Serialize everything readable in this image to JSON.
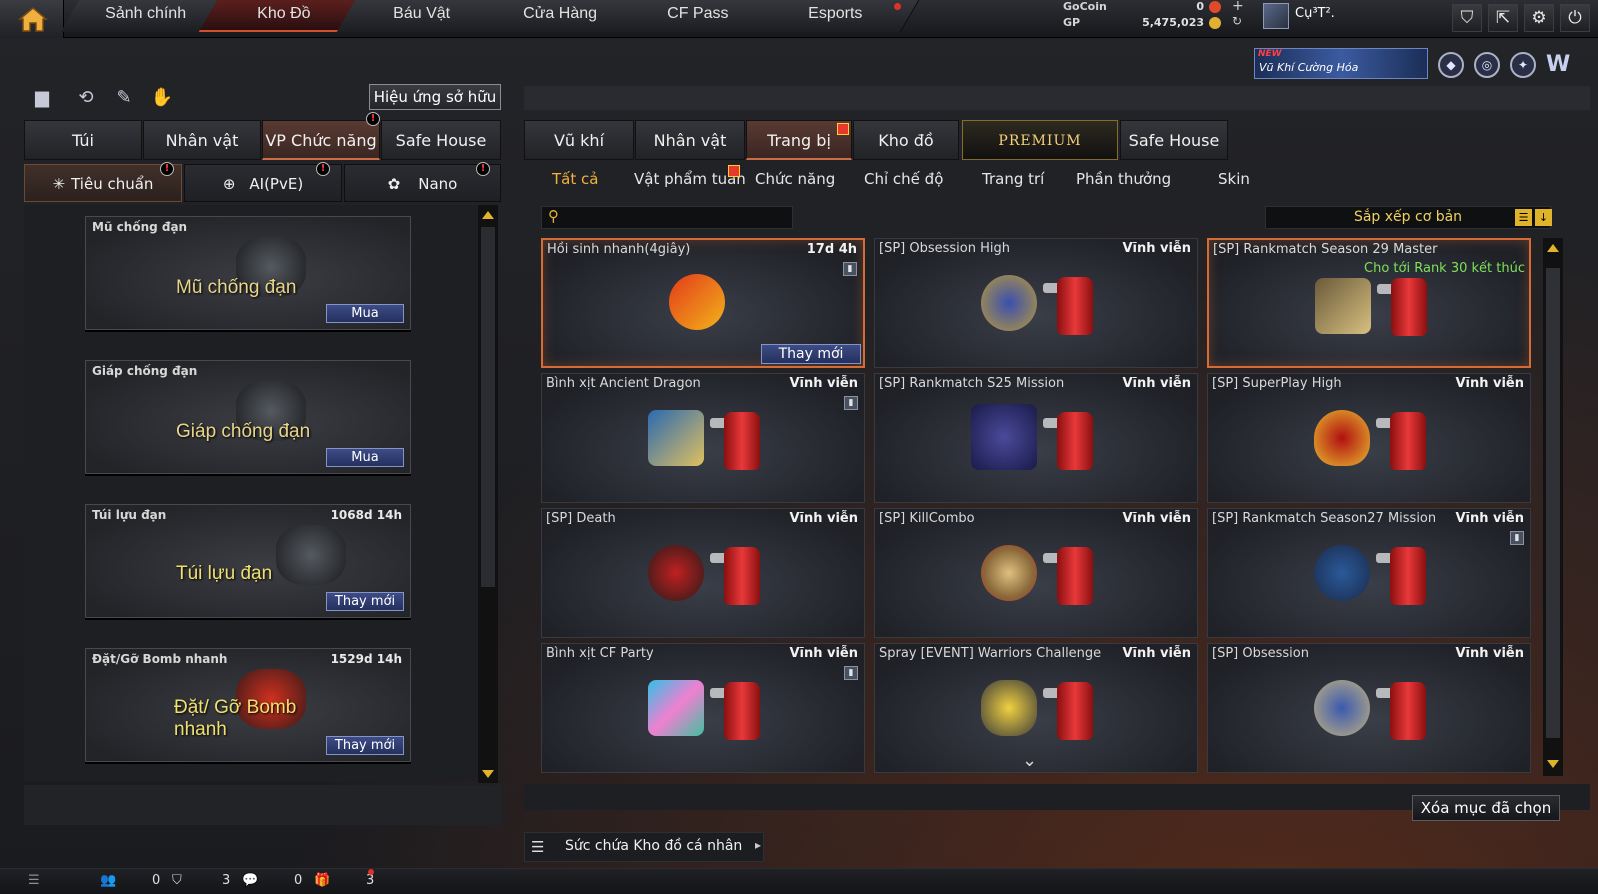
{
  "topbar": {
    "tabs": [
      {
        "label": "Sảnh chính"
      },
      {
        "label": "Kho Đồ"
      },
      {
        "label": "Báu Vật"
      },
      {
        "label": "Cửa Hàng"
      },
      {
        "label": "CF Pass"
      },
      {
        "label": "Esports"
      }
    ],
    "active_tab": 1,
    "currency": [
      {
        "label": "GoCoin",
        "value": "0"
      },
      {
        "label": "GP",
        "value": "5,475,023"
      }
    ],
    "username": "Cụ³T².",
    "accent_color": "#d0502c"
  },
  "banner": {
    "new": "NEW",
    "text": "Vũ Khí Cường Hóa"
  },
  "left": {
    "effects_button": "Hiệu ứng sở hữu",
    "tabs": [
      "Túi",
      "Nhân vật",
      "VP Chức năng",
      "Safe House"
    ],
    "active_tab": 2,
    "subtabs": [
      "Tiêu chuẩn",
      "AI(PvE)",
      "Nano"
    ],
    "active_subtab": 0,
    "items": [
      {
        "title": "Mũ chống đạn",
        "duration": "",
        "art": "Mũ chống đạn",
        "button": "Mua"
      },
      {
        "title": "Giáp chống đạn",
        "duration": "",
        "art": "Giáp chống đạn",
        "button": "Mua"
      },
      {
        "title": "Túi lựu đạn",
        "duration": "1068d 14h",
        "art": "Túi lựu đạn",
        "button": "Thay mới"
      },
      {
        "title": "Đặt/Gỡ Bomb nhanh",
        "duration": "1529d 14h",
        "art": "Đặt/ Gỡ Bomb nhanh",
        "button": "Thay mới"
      }
    ]
  },
  "right": {
    "tabs": [
      "Vũ khí",
      "Nhân vật",
      "Trang bị",
      "Kho đồ",
      "PREMIUM",
      "Safe House"
    ],
    "active_tab": 2,
    "categories": [
      "Tất cả",
      "Vật phẩm tuần",
      "Chức năng",
      "Chỉ chế độ",
      "Trang trí",
      "Phần thưởng",
      "Skin"
    ],
    "active_category": 0,
    "search_placeholder": "",
    "sort_label": "Sắp xếp cơ bản",
    "items": [
      {
        "title": "Hồi sinh nhanh(4giây)",
        "duration": "17d 4h",
        "sub": "",
        "button": "Thay mới",
        "selected": true
      },
      {
        "title": "[SP] Obsession High",
        "duration": "Vĩnh viễn",
        "sub": "",
        "button": "",
        "selected": false
      },
      {
        "title": "[SP] Rankmatch Season 29 Master",
        "duration": "",
        "sub": "Cho tới Rank 30 kết thúc",
        "button": "",
        "selected": true
      },
      {
        "title": "Bình xịt Ancient Dragon",
        "duration": "Vĩnh viễn",
        "sub": "",
        "button": "",
        "selected": false
      },
      {
        "title": "[SP] Rankmatch S25 Mission",
        "duration": "Vĩnh viễn",
        "sub": "",
        "button": "",
        "selected": false
      },
      {
        "title": "[SP] SuperPlay High",
        "duration": "Vĩnh viễn",
        "sub": "",
        "button": "",
        "selected": false
      },
      {
        "title": "[SP] Death",
        "duration": "Vĩnh viễn",
        "sub": "",
        "button": "",
        "selected": false
      },
      {
        "title": "[SP] KillCombo",
        "duration": "Vĩnh viễn",
        "sub": "",
        "button": "",
        "selected": false
      },
      {
        "title": "[SP] Rankmatch Season27 Mission",
        "duration": "Vĩnh viễn",
        "sub": "",
        "button": "",
        "selected": false
      },
      {
        "title": "Bình xịt CF Party",
        "duration": "Vĩnh viễn",
        "sub": "",
        "button": "",
        "selected": false
      },
      {
        "title": "Spray [EVENT] Warriors Challenge",
        "duration": "Vĩnh viễn",
        "sub": "",
        "button": "",
        "selected": false
      },
      {
        "title": "[SP] Obsession",
        "duration": "Vĩnh viễn",
        "sub": "",
        "button": "",
        "selected": false
      }
    ],
    "delete_button": "Xóa mục đã chọn",
    "capacity_label": "Sức chứa Kho đồ cá nhân"
  },
  "bottom": {
    "counts": [
      "0",
      "3",
      "0",
      "3"
    ]
  }
}
